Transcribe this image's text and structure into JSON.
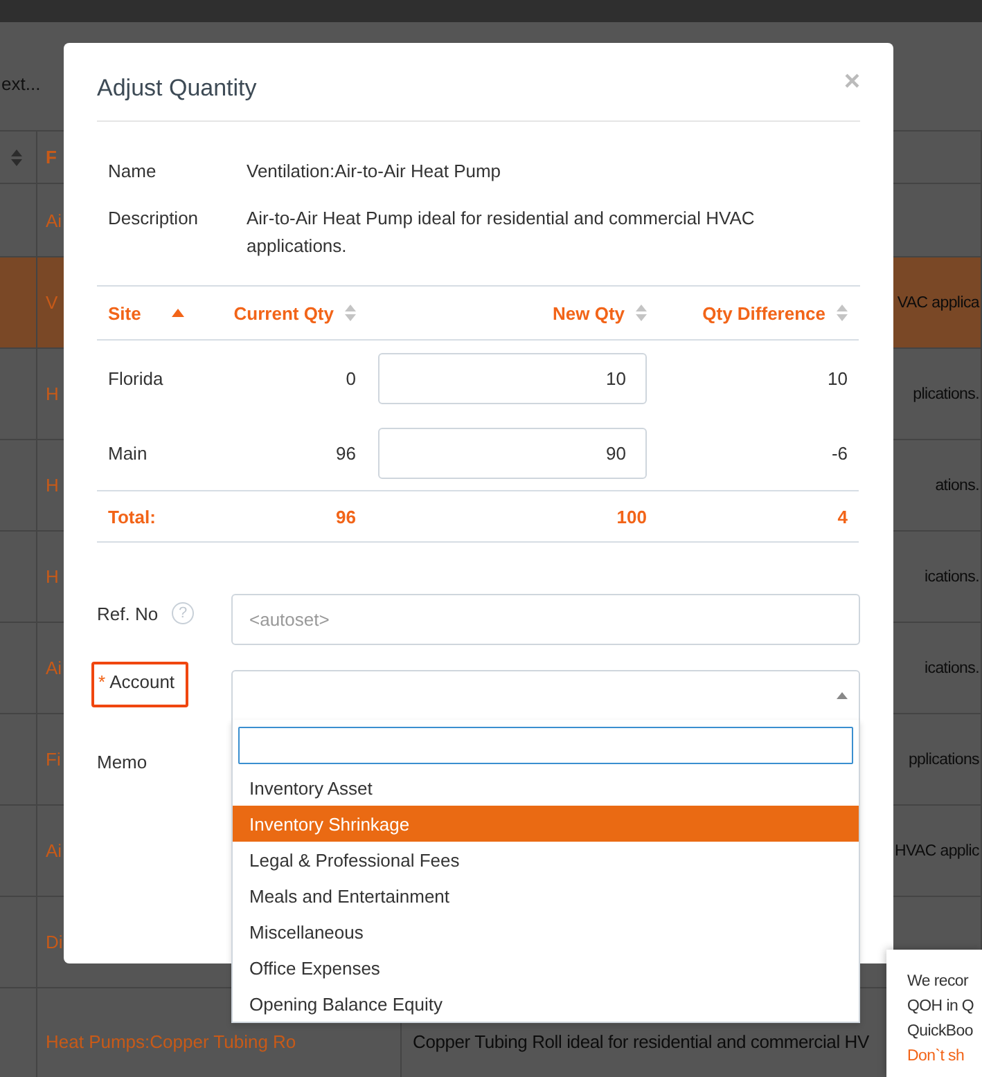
{
  "background": {
    "search_text": "ext...",
    "header": "F",
    "rows": [
      {
        "kind": "fragment",
        "col_1": "Ai",
        "selected": false
      },
      {
        "kind": "fragment",
        "col_1": "V",
        "col_2": "VAC applica",
        "selected": true
      },
      {
        "kind": "fragment",
        "col_1": "H",
        "col_2": "plications.",
        "selected": false
      },
      {
        "kind": "fragment",
        "col_1": "H",
        "col_2": "ations.",
        "selected": false
      },
      {
        "kind": "fragment",
        "col_1": "H",
        "col_2": "ications.",
        "selected": false
      },
      {
        "kind": "fragment",
        "col_1": "Ai",
        "col_2": "ications.",
        "selected": false
      },
      {
        "kind": "fragment",
        "col_1": "Fi",
        "col_2": "pplications",
        "selected": false
      },
      {
        "kind": "fragment",
        "col_1": "Ai",
        "col_2": "HVAC applic",
        "selected": false
      },
      {
        "kind": "fragment",
        "col_1": "Di",
        "selected": false
      },
      {
        "kind": "text",
        "col_1": "Heat Pumps:Copper Tubing Ro",
        "col_2": "Copper Tubing Roll ideal for residential and commercial HV",
        "selected": false
      }
    ]
  },
  "modal": {
    "title": "Adjust Quantity",
    "close": "×",
    "details": [
      {
        "label": "Name",
        "value": "Ventilation:Air-to-Air Heat Pump"
      },
      {
        "label": "Description",
        "value": "Air-to-Air Heat Pump ideal for residential and commercial HVAC applications."
      }
    ],
    "qty_table": {
      "columns": [
        {
          "label": "Site",
          "sorted": true
        },
        {
          "label": "Current Qty",
          "sorted": false
        },
        {
          "label": "New Qty",
          "sorted": false
        },
        {
          "label": "Qty Difference",
          "sorted": false
        }
      ],
      "rows": [
        {
          "site": "Florida",
          "current": "0",
          "new": "10",
          "diff": "10"
        },
        {
          "site": "Main",
          "current": "96",
          "new": "90",
          "diff": "-6"
        }
      ],
      "total": {
        "label": "Total:",
        "current": "96",
        "new": "100",
        "diff": "4"
      }
    },
    "form": {
      "ref_no": {
        "label": "Ref. No",
        "help": "?",
        "placeholder": "<autoset>"
      },
      "account": {
        "label": "Account",
        "required_mark": "*",
        "highlighted": true,
        "expanded": true,
        "options": [
          {
            "label": "Inventory Asset",
            "selected": false
          },
          {
            "label": "Inventory Shrinkage",
            "selected": true
          },
          {
            "label": "Legal & Professional Fees",
            "selected": false
          },
          {
            "label": "Meals and Entertainment",
            "selected": false
          },
          {
            "label": "Miscellaneous",
            "selected": false
          },
          {
            "label": "Office Expenses",
            "selected": false
          },
          {
            "label": "Opening Balance Equity",
            "selected": false
          }
        ]
      },
      "memo": {
        "label": "Memo"
      }
    }
  },
  "toast": {
    "lines": [
      "We recor",
      "QOH in Q",
      "QuickBoo"
    ],
    "link": "Don`t sh"
  }
}
